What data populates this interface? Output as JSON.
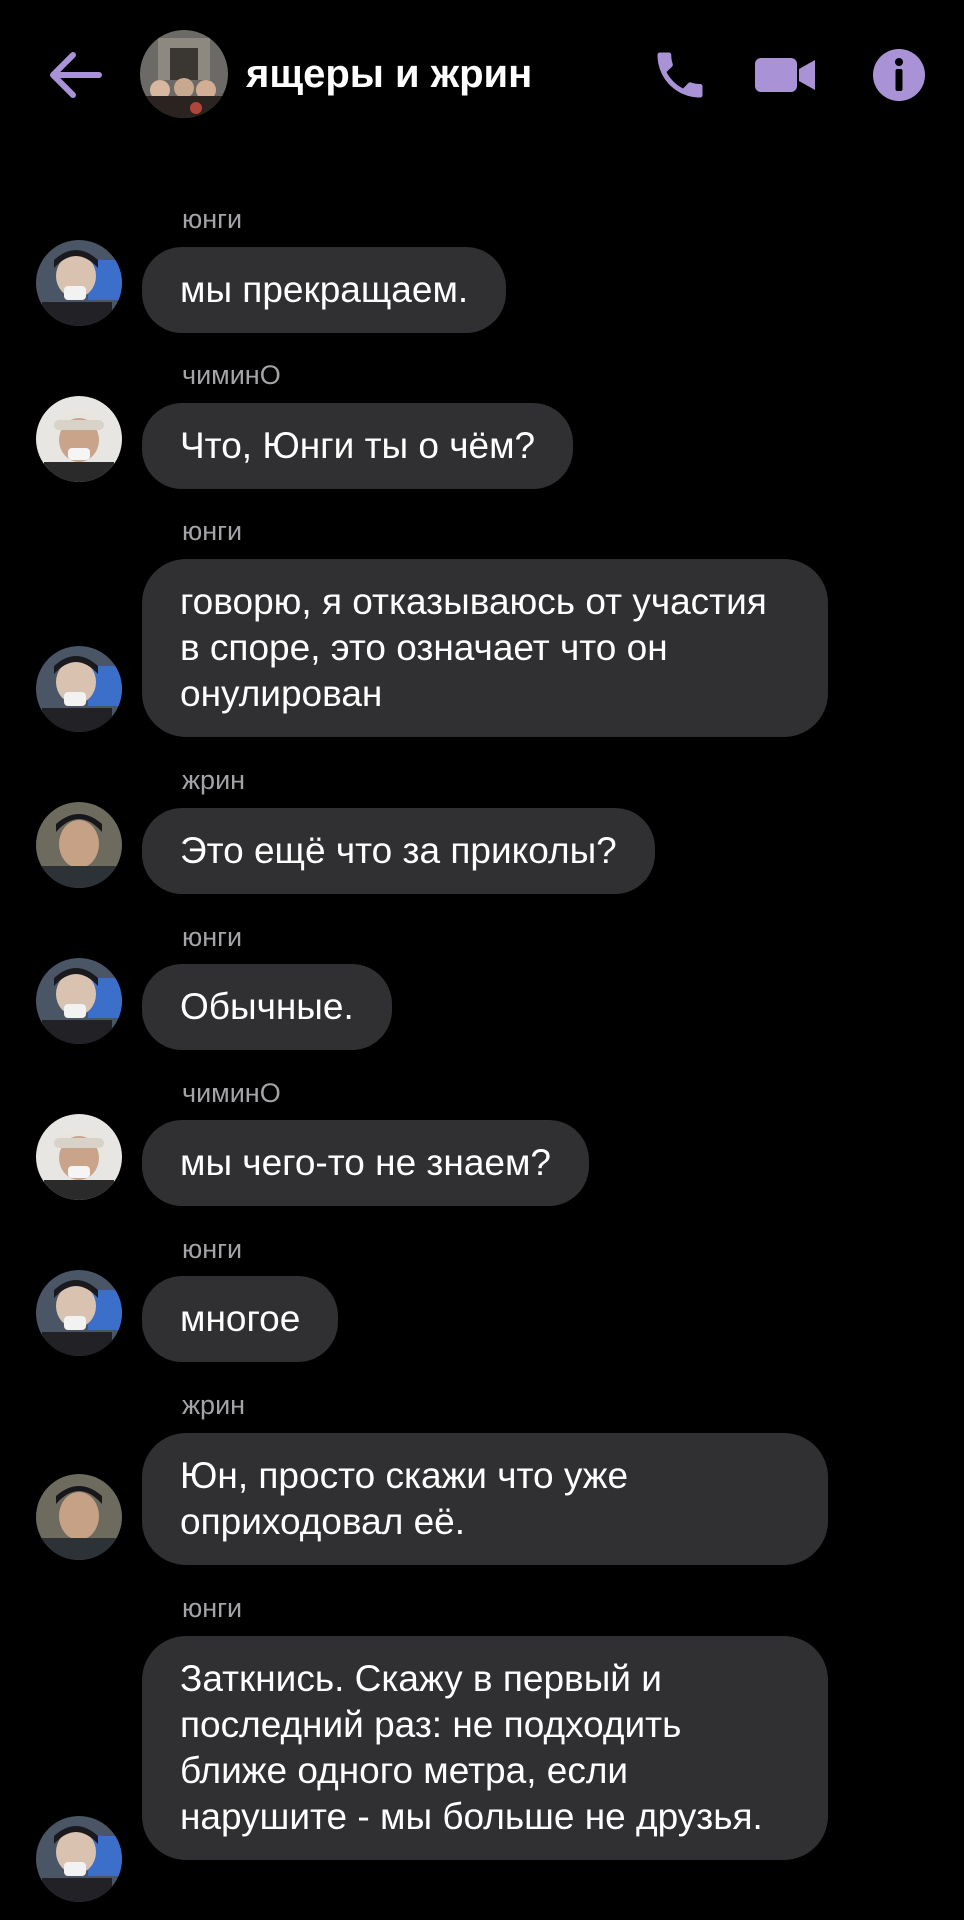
{
  "header": {
    "title": "ящеры и жрин",
    "back_icon": "arrow-left-icon",
    "call_icon": "phone-icon",
    "video_icon": "video-camera-icon",
    "info_icon": "info-icon"
  },
  "colors": {
    "accent": "#a993d6",
    "background": "#000000",
    "bubble": "#303032",
    "sender_text": "#a4a4a8"
  },
  "messages": [
    {
      "sender": "юнги",
      "text": "мы прекращаем."
    },
    {
      "sender": "чиминО",
      "text": "Что, Юнги ты о чём?"
    },
    {
      "sender": "юнги",
      "text": "говорю, я отказываюсь от участия в споре, это означает что он онулирован"
    },
    {
      "sender": "жрин",
      "text": "Это ещё что за приколы?"
    },
    {
      "sender": "юнги",
      "text": "Обычные."
    },
    {
      "sender": "чиминО",
      "text": "мы чего-то не знаем?"
    },
    {
      "sender": "юнги",
      "text": "многое"
    },
    {
      "sender": "жрин",
      "text": "Юн, просто скажи что уже оприходовал её."
    },
    {
      "sender": "юнги",
      "text": "Заткнись. Скажу в первый и последний раз: не подходить ближе одного метра, если нарушите - мы больше не друзья."
    }
  ]
}
